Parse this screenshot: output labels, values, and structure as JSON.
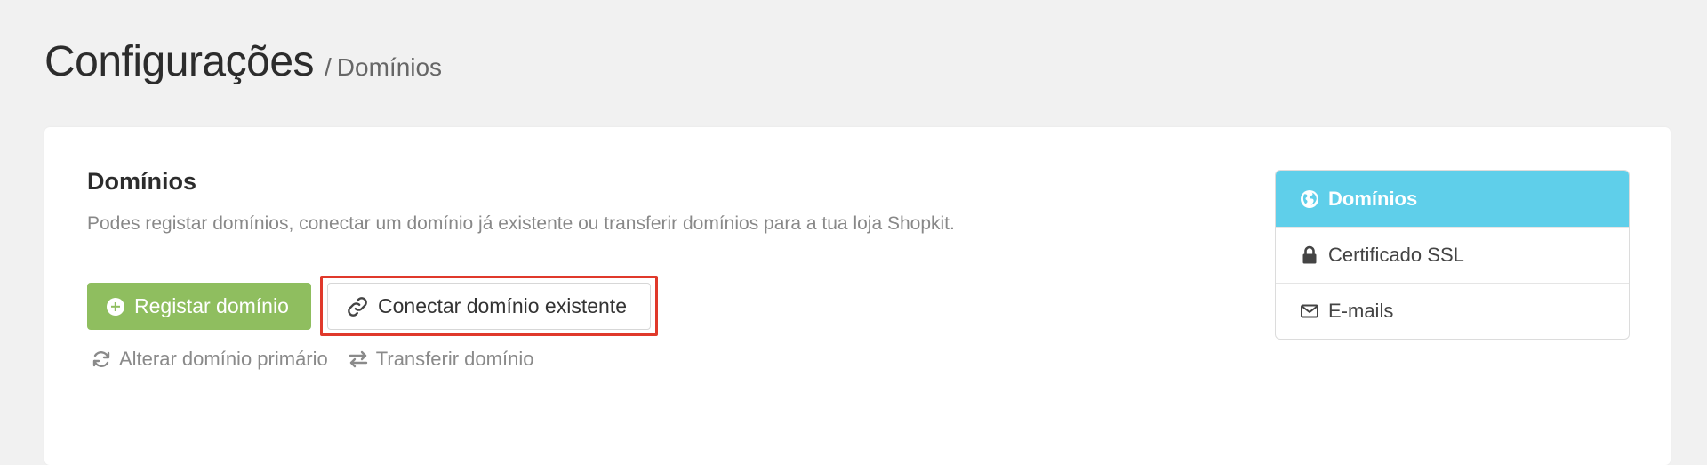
{
  "header": {
    "title": "Configurações",
    "separator": "/",
    "breadcrumb": "Domínios"
  },
  "section": {
    "title": "Domínios",
    "description": "Podes registar domínios, conectar um domínio já existente ou transferir domínios para a tua loja Shopkit."
  },
  "actions": {
    "register_label": "Registar domínio",
    "connect_label": "Conectar domínio existente",
    "change_primary_label": "Alterar domínio primário",
    "transfer_label": "Transferir domínio"
  },
  "side_menu": {
    "items": [
      {
        "label": "Domínios",
        "icon": "globe-icon",
        "active": true
      },
      {
        "label": "Certificado SSL",
        "icon": "lock-icon",
        "active": false
      },
      {
        "label": "E-mails",
        "icon": "envelope-icon",
        "active": false
      }
    ]
  },
  "colors": {
    "page_bg": "#f1f1f1",
    "primary_button": "#8fbe5f",
    "active_menu": "#5fcfea",
    "highlight": "#e0392b"
  }
}
